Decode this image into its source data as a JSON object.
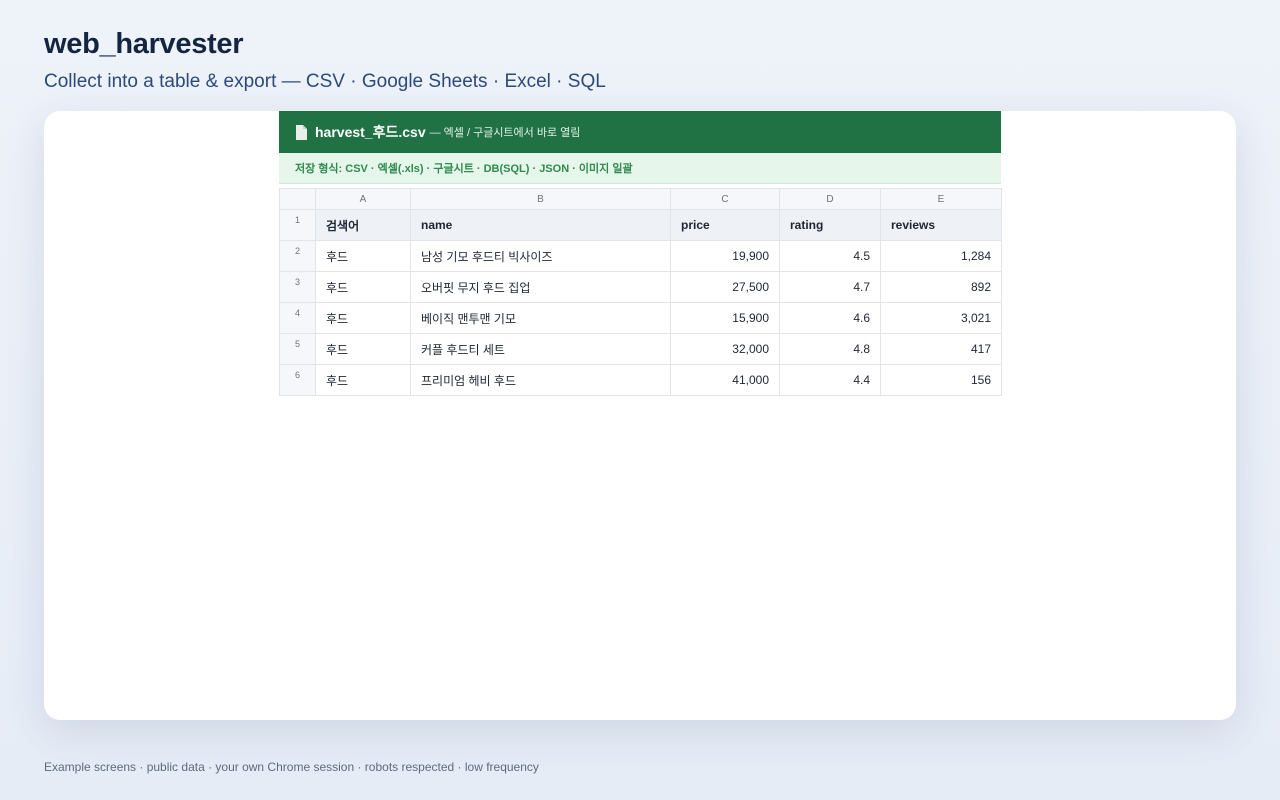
{
  "app": {
    "title": "web_harvester",
    "subtitle": "Collect into a table & export — CSV · Google Sheets · Excel · SQL"
  },
  "sheet": {
    "file_icon": "file-icon",
    "file_name": "harvest_후드.csv",
    "file_hint": "— 엑셀 / 구글시트에서 바로 열림",
    "formats": "저장 형식: CSV · 엑셀(.xls) · 구글시트 · DB(SQL) · JSON · 이미지 일괄",
    "column_letters": [
      "A",
      "B",
      "C",
      "D",
      "E"
    ],
    "headers": [
      "검색어",
      "name",
      "price",
      "rating",
      "reviews"
    ],
    "rows": [
      {
        "num": "2",
        "query": "후드",
        "name": "남성 기모 후드티 빅사이즈",
        "price": "19,900",
        "rating": "4.5",
        "reviews": "1,284"
      },
      {
        "num": "3",
        "query": "후드",
        "name": "오버핏 무지 후드 집업",
        "price": "27,500",
        "rating": "4.7",
        "reviews": "892"
      },
      {
        "num": "4",
        "query": "후드",
        "name": "베이직 맨투맨 기모",
        "price": "15,900",
        "rating": "4.6",
        "reviews": "3,021"
      },
      {
        "num": "5",
        "query": "후드",
        "name": "커플 후드티 세트",
        "price": "32,000",
        "rating": "4.8",
        "reviews": "417"
      },
      {
        "num": "6",
        "query": "후드",
        "name": "프리미엄 헤비 후드",
        "price": "41,000",
        "rating": "4.4",
        "reviews": "156"
      }
    ],
    "header_row_num": "1"
  },
  "footer": {
    "note": "Example screens · public data · your own Chrome session · robots respected · low frequency"
  },
  "colors": {
    "sheet_header": "#207144",
    "format_bar": "#e6f6eb",
    "format_text": "#2f8a4e"
  }
}
